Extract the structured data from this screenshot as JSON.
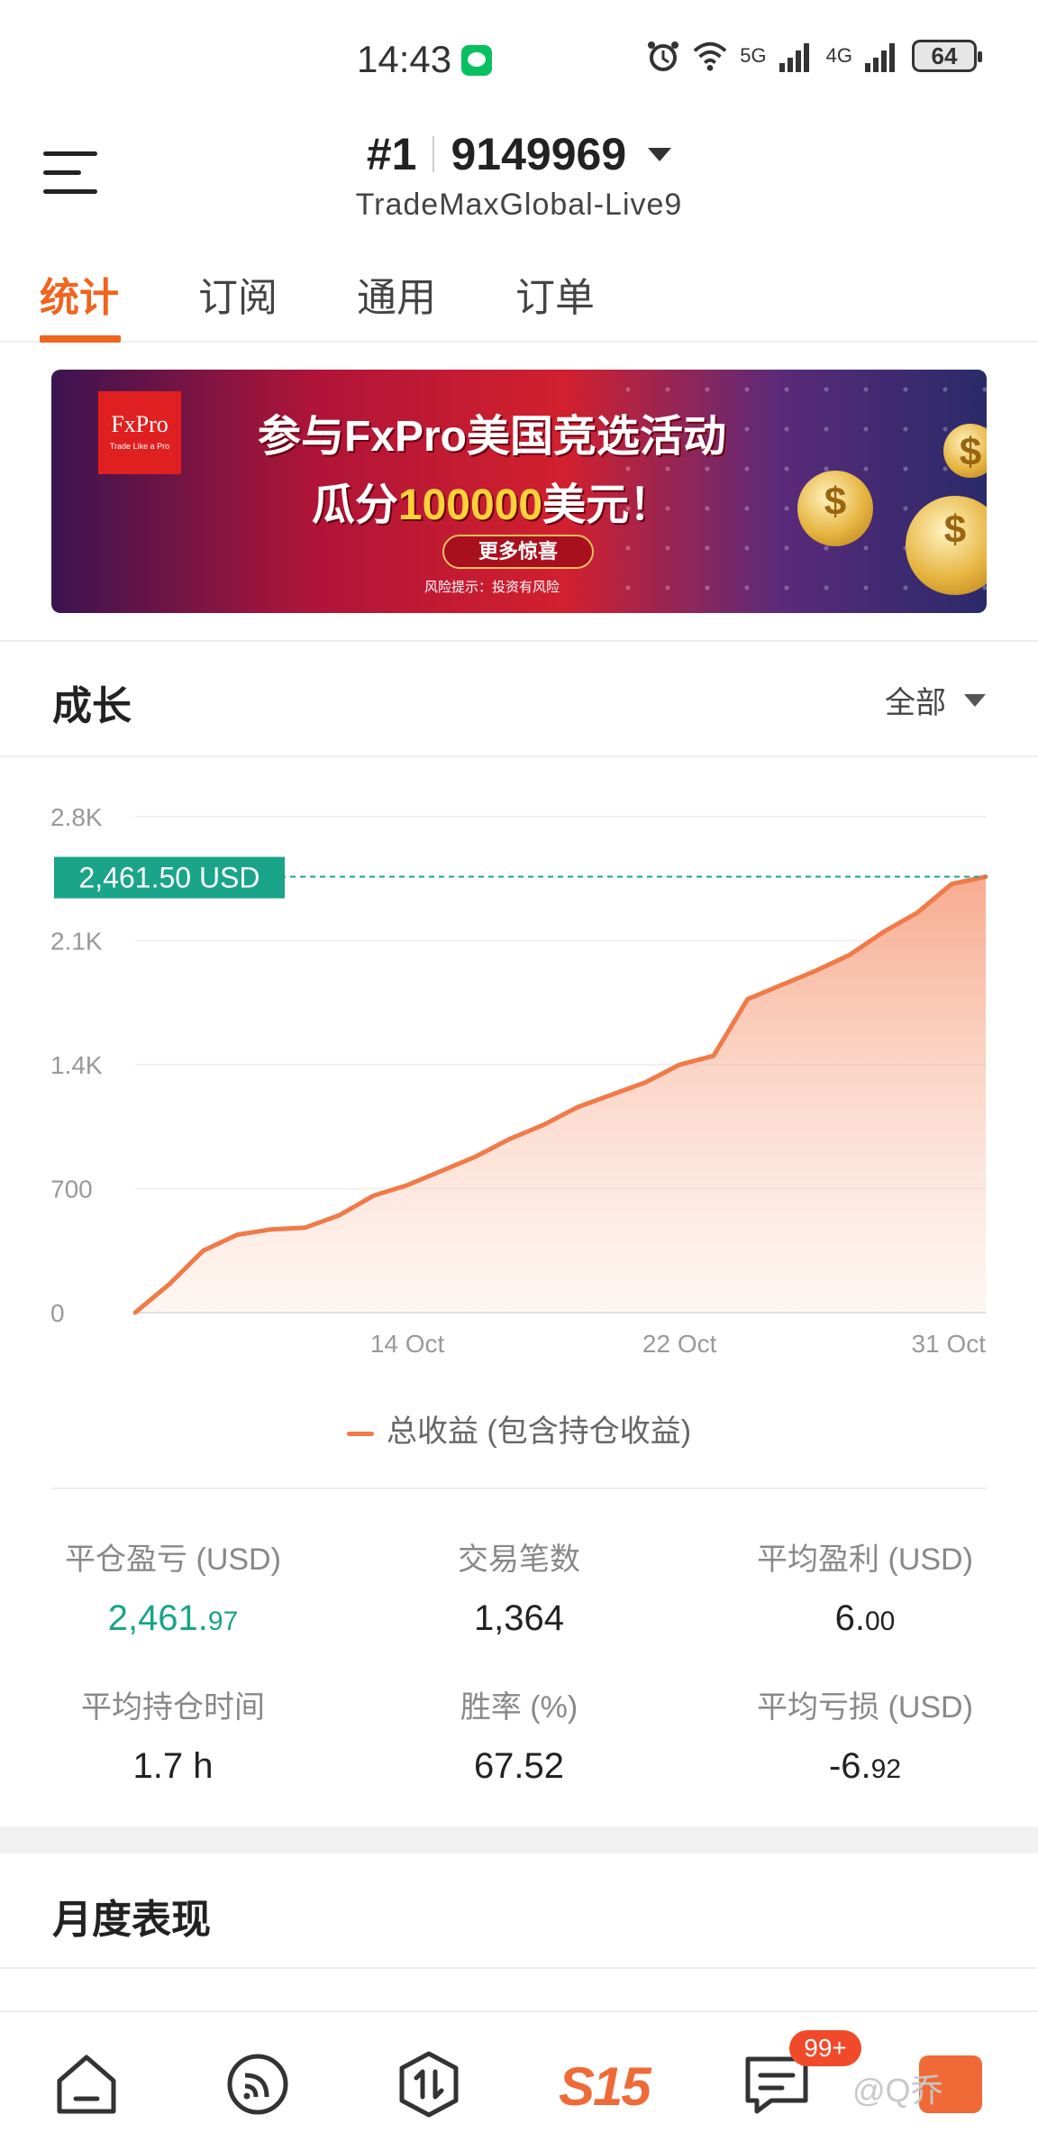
{
  "status_bar": {
    "time": "14:43",
    "icons": [
      "wechat-notification-icon",
      "alarm-icon",
      "wifi-icon",
      "signal-5g-icon",
      "signal-4g-icon"
    ],
    "signal_5g": "5G",
    "signal_4g": "4G",
    "battery": "64"
  },
  "header": {
    "rank": "#1",
    "account_id": "9149969",
    "server": "TradeMaxGlobal-Live9"
  },
  "tabs": [
    {
      "label": "统计",
      "active": true
    },
    {
      "label": "订阅",
      "active": false
    },
    {
      "label": "通用",
      "active": false
    },
    {
      "label": "订单",
      "active": false
    }
  ],
  "banner": {
    "logo_text": "FxPro",
    "logo_slogan": "Trade Like a Pro",
    "line1": "参与FxPro美国竞选活动",
    "line2_prefix": "瓜分",
    "line2_highlight": "100000",
    "line2_suffix": "美元！",
    "button": "更多惊喜",
    "risk": "风险提示：投资有风险"
  },
  "growth": {
    "title": "成长",
    "filter": "全部"
  },
  "chart_data": {
    "type": "area",
    "ylim": [
      0,
      2800
    ],
    "y_ticks": [
      "0",
      "700",
      "1.4K",
      "2.1K",
      "2.8K"
    ],
    "y_tick_values": [
      0,
      700,
      1400,
      2100,
      2800
    ],
    "x_tick_labels": [
      "14 Oct",
      "22 Oct",
      "31 Oct"
    ],
    "current_value_label": "2,461.50 USD",
    "current_value": 2461.5,
    "grid": true,
    "series": [
      {
        "name": "总收益 (包含持仓收益)",
        "color": "#f07a48",
        "points": [
          [
            "6 Oct",
            0
          ],
          [
            "7 Oct",
            160
          ],
          [
            "8 Oct",
            350
          ],
          [
            "9 Oct",
            440
          ],
          [
            "10 Oct",
            470
          ],
          [
            "11 Oct",
            480
          ],
          [
            "12 Oct",
            550
          ],
          [
            "13 Oct",
            660
          ],
          [
            "14 Oct",
            720
          ],
          [
            "15 Oct",
            800
          ],
          [
            "16 Oct",
            880
          ],
          [
            "17 Oct",
            980
          ],
          [
            "18 Oct",
            1060
          ],
          [
            "19 Oct",
            1160
          ],
          [
            "20 Oct",
            1230
          ],
          [
            "21 Oct",
            1300
          ],
          [
            "22 Oct",
            1400
          ],
          [
            "23 Oct",
            1450
          ],
          [
            "24 Oct",
            1770
          ],
          [
            "25 Oct",
            1850
          ],
          [
            "26 Oct",
            1930
          ],
          [
            "27 Oct",
            2020
          ],
          [
            "28 Oct",
            2150
          ],
          [
            "29 Oct",
            2260
          ],
          [
            "30 Oct",
            2420
          ],
          [
            "31 Oct",
            2461.5
          ]
        ]
      }
    ]
  },
  "legend": {
    "label": "总收益 (包含持仓收益)"
  },
  "stats": {
    "closed_pnl_label": "平仓盈亏 (USD)",
    "closed_pnl_int": "2,461.",
    "closed_pnl_frac": "97",
    "trades_label": "交易笔数",
    "trades": "1,364",
    "avg_profit_label": "平均盈利 (USD)",
    "avg_profit_int": "6.",
    "avg_profit_frac": "00",
    "avg_hold_label": "平均持仓时间",
    "avg_hold": "1.7 h",
    "win_rate_label": "胜率 (%)",
    "win_rate": "67.52",
    "avg_loss_label": "平均亏损 (USD)",
    "avg_loss_int": "-6.",
    "avg_loss_frac": "92"
  },
  "monthly": {
    "title": "月度表现"
  },
  "bottom_nav": {
    "items": [
      "home-icon",
      "feed-icon",
      "trade-icon",
      "s15-icon",
      "message-icon",
      "more-icon"
    ],
    "s15_label": "S15",
    "message_badge": "99+"
  },
  "watermark": "@Q乔",
  "colors": {
    "accent": "#f0641e",
    "chart_line": "#f07a48",
    "profit_green": "#1aa489",
    "value_label_bg": "#1aa489"
  }
}
